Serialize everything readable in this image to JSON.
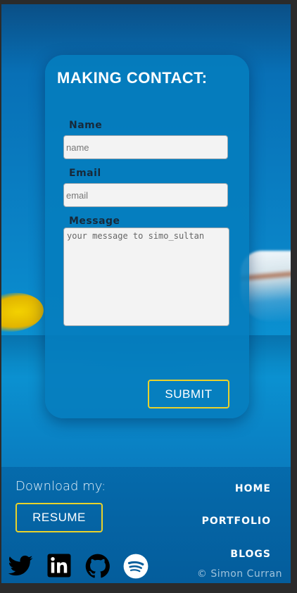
{
  "contact": {
    "title": "MAKING CONTACT:",
    "name_label": "Name",
    "name_placeholder": "name",
    "email_label": "Email",
    "email_placeholder": "email",
    "message_label": "Message",
    "message_placeholder": "your message to simo_sultan",
    "submit_label": "SUBMIT"
  },
  "footer": {
    "download_label": "Download my:",
    "resume_label": "RESUME",
    "nav": {
      "home": "HOME",
      "portfolio": "PORTFOLIO",
      "blogs": "BLOGS"
    },
    "social_icons": [
      "twitter-icon",
      "linkedin-icon",
      "github-icon",
      "spotify-icon"
    ],
    "copyright": "© Simon Curran"
  },
  "colors": {
    "accent_border": "#e9d22b",
    "card_bg": "#057dbe",
    "label_text": "#17293a"
  }
}
